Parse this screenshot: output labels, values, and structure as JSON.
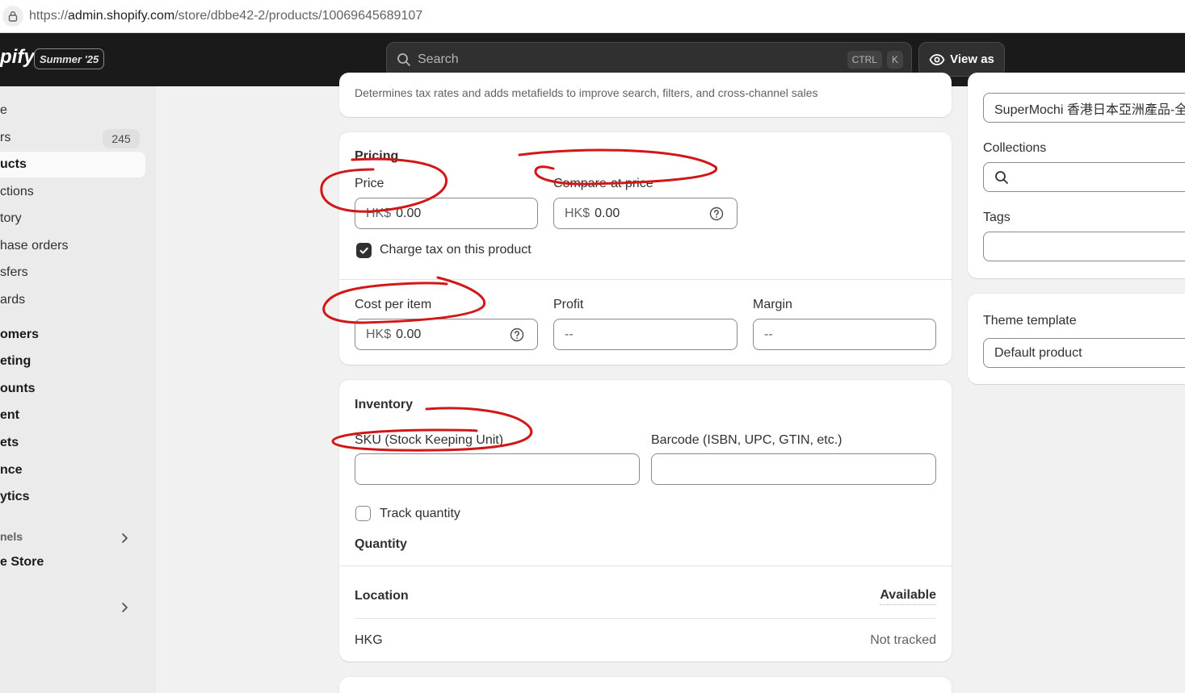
{
  "browser": {
    "url_prefix": "https://",
    "url_host": "admin.shopify.com",
    "url_path": "/store/dbbe42-2/products/10069645689107"
  },
  "topbar": {
    "brand": "pify",
    "edition": "Summer '25",
    "search_placeholder": "Search",
    "shortcut_ctrl": "CTRL",
    "shortcut_k": "K",
    "view_as": "View as"
  },
  "sidebar": {
    "items": [
      {
        "label": "e"
      },
      {
        "label": "rs",
        "badge": "245"
      },
      {
        "label": "ucts"
      },
      {
        "label": "ctions"
      },
      {
        "label": "tory"
      },
      {
        "label": "hase orders"
      },
      {
        "label": "sfers"
      },
      {
        "label": "ards"
      },
      {
        "label": "omers"
      },
      {
        "label": "eting"
      },
      {
        "label": "ounts"
      },
      {
        "label": "ent"
      },
      {
        "label": "ets"
      },
      {
        "label": "nce"
      },
      {
        "label": "ytics"
      },
      {
        "label": "nels"
      },
      {
        "label": "e Store"
      }
    ]
  },
  "category_card": {
    "help_text": "Determines tax rates and adds metafields to improve search, filters, and cross-channel sales"
  },
  "pricing": {
    "title": "Pricing",
    "price_label": "Price",
    "price_prefix": "HK$",
    "price_value": "0.00",
    "compare_label": "Compare-at price",
    "compare_prefix": "HK$",
    "compare_value": "0.00",
    "charge_tax_label": "Charge tax on this product",
    "charge_tax_checked": true,
    "cost_label": "Cost per item",
    "cost_prefix": "HK$",
    "cost_value": "0.00",
    "profit_label": "Profit",
    "profit_value": "--",
    "margin_label": "Margin",
    "margin_value": "--"
  },
  "inventory": {
    "title": "Inventory",
    "sku_label": "SKU (Stock Keeping Unit)",
    "sku_value": "",
    "barcode_label": "Barcode (ISBN, UPC, GTIN, etc.)",
    "barcode_value": "",
    "track_quantity_label": "Track quantity",
    "track_quantity_checked": false,
    "quantity_heading": "Quantity",
    "location_header": "Location",
    "available_header": "Available",
    "rows": [
      {
        "location": "HKG",
        "available": "Not tracked"
      }
    ]
  },
  "organization": {
    "vendor_value": "SuperMochi 香港日本亞洲產品-全",
    "collections_label": "Collections",
    "tags_label": "Tags",
    "tags_value": ""
  },
  "theme": {
    "label": "Theme template",
    "value": "Default product"
  },
  "colors": {
    "annotation": "#d01818",
    "topbar": "#1a1a1a",
    "sidebar": "#ebebeb",
    "page": "#f1f1f1"
  }
}
